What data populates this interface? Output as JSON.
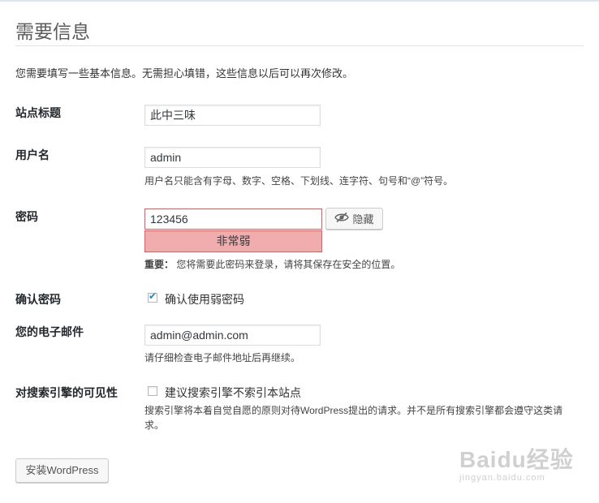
{
  "page": {
    "title": "需要信息",
    "intro": "您需要填写一些基本信息。无需担心填错，这些信息以后可以再次修改。"
  },
  "site_title": {
    "label": "站点标题",
    "value": "此中三味"
  },
  "username": {
    "label": "用户名",
    "value": "admin",
    "hint": "用户名只能含有字母、数字、空格、下划线、连字符、句号和“@”符号。"
  },
  "password": {
    "label": "密码",
    "value": "123456",
    "hide_label": "隐藏",
    "strength": "非常弱",
    "note_bold": "重要：",
    "note": "您将需要此密码来登录，请将其保存在安全的位置。"
  },
  "confirm_password": {
    "label": "确认密码",
    "checkbox_label": "确认使用弱密码",
    "checked": true
  },
  "email": {
    "label": "您的电子邮件",
    "value": "admin@admin.com",
    "hint": "请仔细检查电子邮件地址后再继续。"
  },
  "visibility": {
    "label": "对搜索引擎的可见性",
    "checkbox_label": "建议搜索引擎不索引本站点",
    "checked": false,
    "hint": "搜索引擎将本着自觉自愿的原则对待WordPress提出的请求。并不是所有搜索引擎都会遵守这类请求。"
  },
  "install_button": "安装WordPress",
  "watermark": {
    "main": "Baidu经验",
    "sub": "jingyan.baidu.com"
  },
  "icons": {
    "hide": "eye-slash-icon",
    "check": "checkmark-icon"
  }
}
